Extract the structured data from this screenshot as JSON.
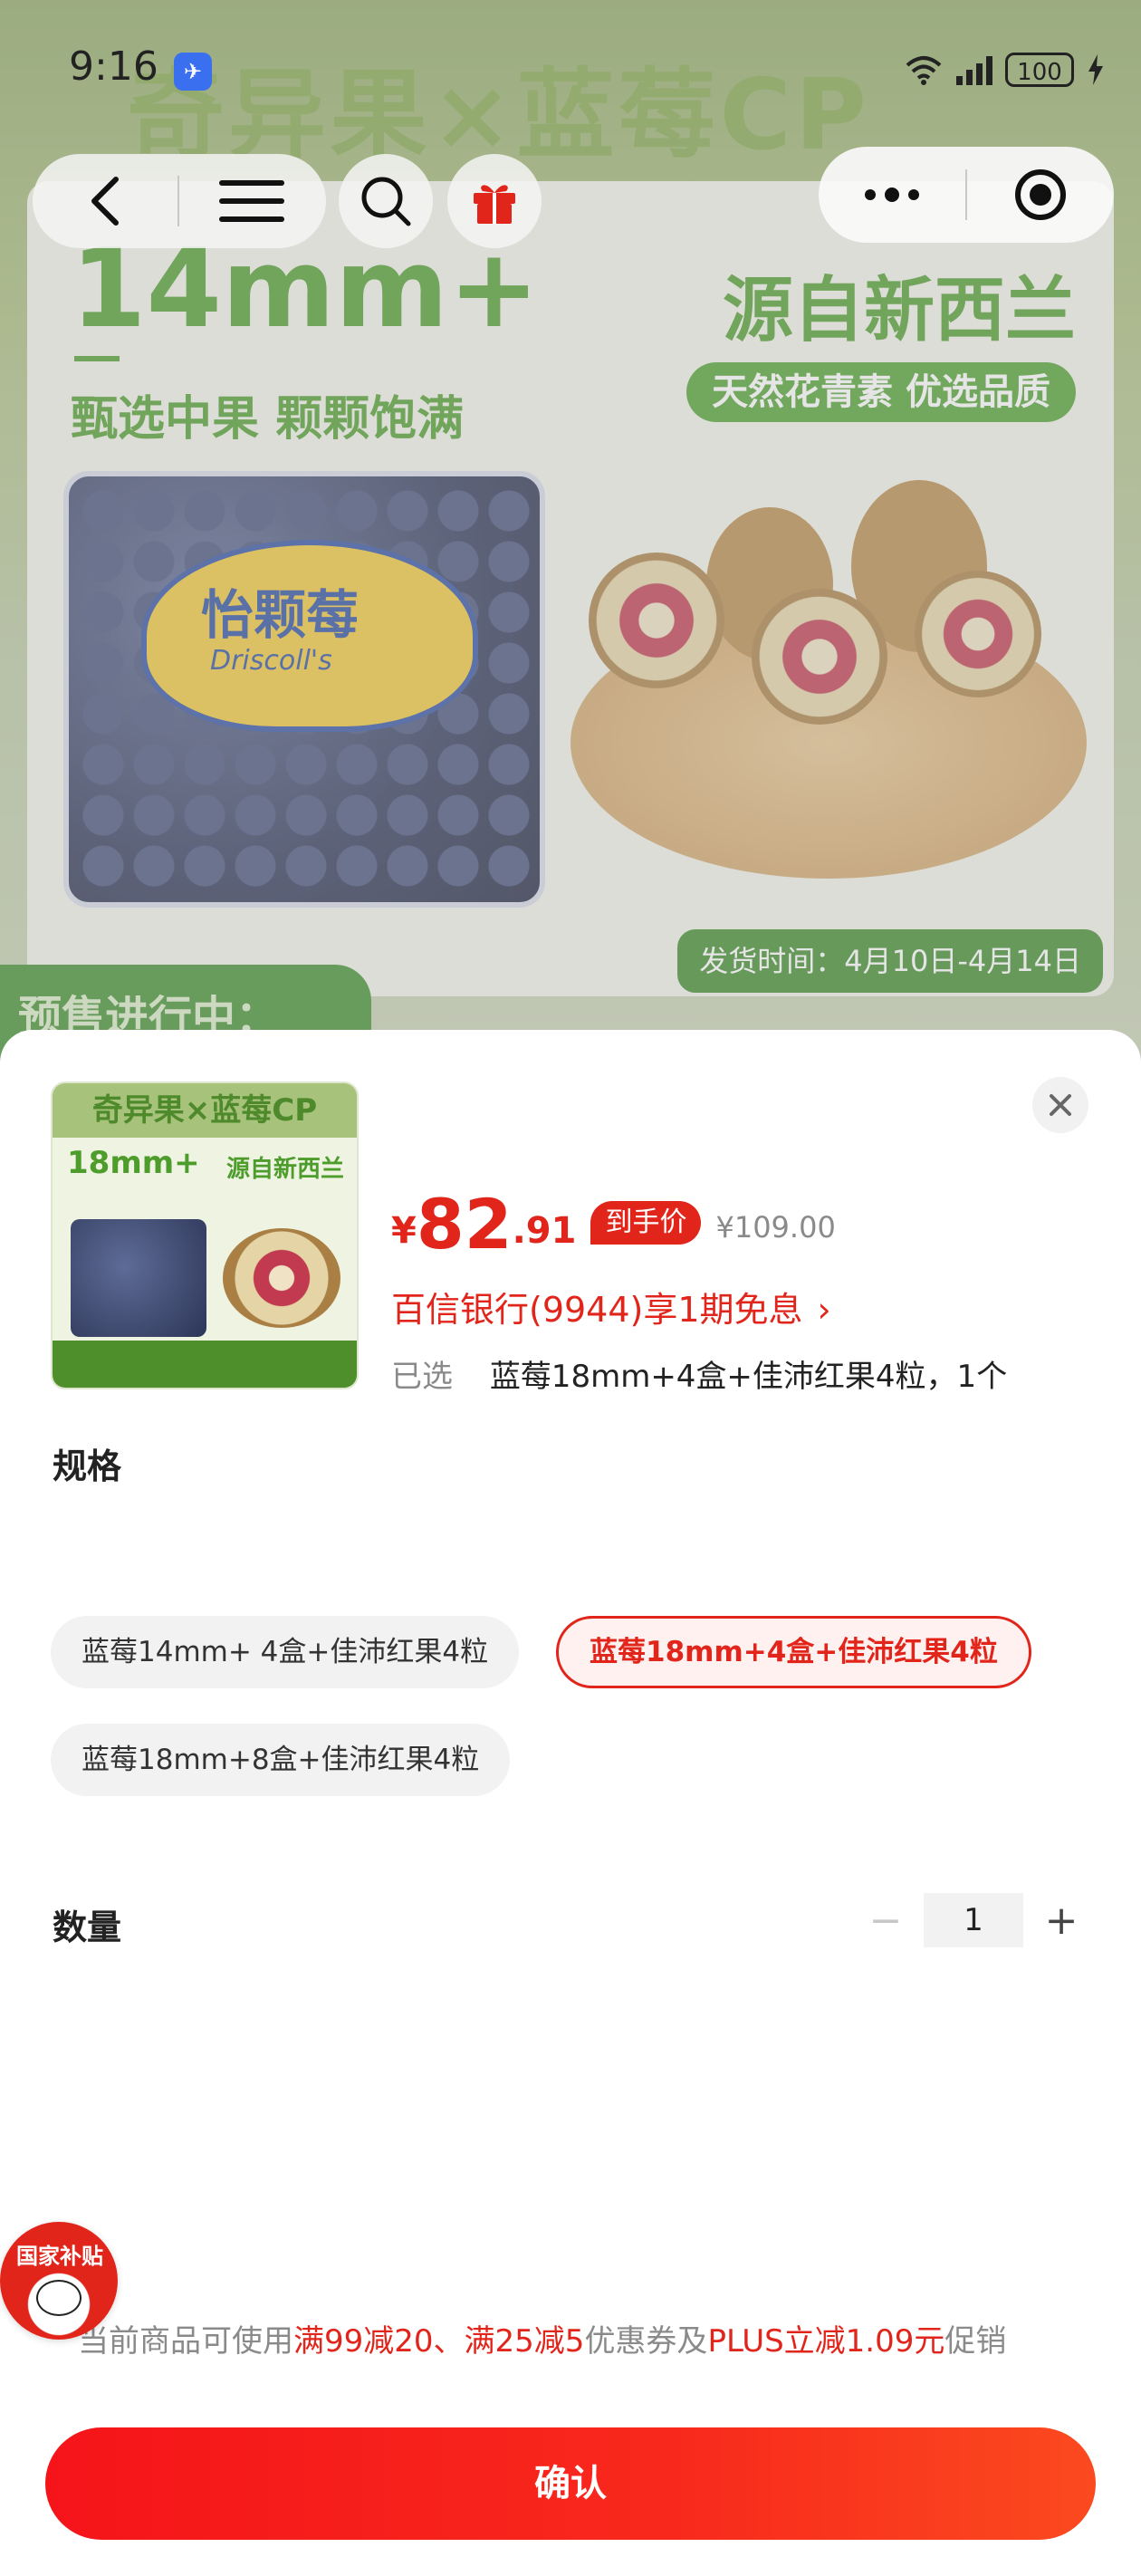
{
  "status_bar": {
    "time": "9:16",
    "battery": "100"
  },
  "background": {
    "headline": "奇异果×蓝莓CP",
    "size_text": "14mm+",
    "subtitle": "甄选中果 颗颗饱满",
    "origin": "源自新西兰",
    "pill": "天然花青素 优选品质",
    "berry_brand": "怡颗莓",
    "berry_brand_en": "Driscoll's",
    "ship_time": "发货时间：4月10日-4月14日",
    "presale": "预售进行中："
  },
  "product": {
    "thumb_title": "奇异果×蓝莓CP",
    "thumb_size": "18mm+",
    "thumb_origin": "源自新西兰",
    "price_currency": "¥",
    "price_int": "82",
    "price_dec": ".91",
    "price_tag": "到手价",
    "price_old": "¥109.00",
    "installment": "百信银行(9944)享1期免息",
    "installment_arrow": "›",
    "selected_label": "已选",
    "selected_value": "蓝莓18mm+4盒+佳沛红果4粒，1个"
  },
  "spec": {
    "title": "规格",
    "options": [
      {
        "label": "蓝莓14mm+ 4盒+佳沛红果4粒",
        "selected": false
      },
      {
        "label": "蓝莓18mm+4盒+佳沛红果4粒",
        "selected": true
      },
      {
        "label": "蓝莓18mm+8盒+佳沛红果4粒",
        "selected": false
      }
    ]
  },
  "quantity": {
    "title": "数量",
    "value": "1",
    "minus": "−",
    "plus": "+"
  },
  "subsidy": {
    "label": "国家补贴"
  },
  "promo": {
    "prefix": "当前商品可使用",
    "coupons": "满99减20、满25减5",
    "middle": "优惠券及",
    "plus": "PLUS立减1.09元",
    "suffix": "促销"
  },
  "confirm_label": "确认",
  "colors": {
    "accent": "#e1251b",
    "brand_green": "#4e9d2c"
  }
}
